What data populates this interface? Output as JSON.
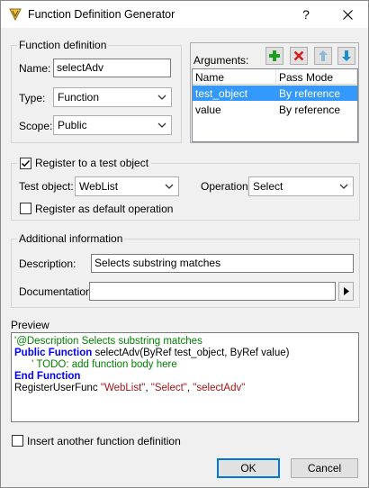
{
  "window": {
    "title": "Function Definition Generator",
    "help": "?",
    "close": "✕"
  },
  "function_definition": {
    "legend": "Function definition",
    "name_label": "Name:",
    "name_value": "selectAdv",
    "type_label": "Type:",
    "type_value": "Function",
    "scope_label": "Scope:",
    "scope_value": "Public"
  },
  "arguments": {
    "label": "Arguments:",
    "columns": [
      "Name",
      "Pass Mode"
    ],
    "rows": [
      {
        "name": "test_object",
        "mode": "By reference"
      },
      {
        "name": "value",
        "mode": "By reference"
      }
    ]
  },
  "register": {
    "legend": "Register to a test object",
    "checked": true,
    "test_object_label": "Test object:",
    "test_object_value": "WebList",
    "operation_label": "Operation:",
    "operation_value": "Select",
    "default_op_label": "Register as default operation",
    "default_op_checked": false
  },
  "additional": {
    "legend": "Additional information",
    "description_label": "Description:",
    "description_value": "Selects substring matches",
    "documentation_label": "Documentation:",
    "documentation_value": ""
  },
  "preview": {
    "label": "Preview",
    "line1": "'@Description Selects substring matches",
    "line2_kw": "Public Function",
    "line2_rest": " selectAdv(ByRef test_object, ByRef value)",
    "line3": "' TODO: add function body here",
    "line4_kw": "End Function",
    "line5_a": "RegisterUserFunc ",
    "line5_s1": "\"WebList\"",
    "line5_c1": ", ",
    "line5_s2": "\"Select\"",
    "line5_c2": ", ",
    "line5_s3": "\"selectAdv\""
  },
  "footer": {
    "insert_another_label": "Insert another function definition",
    "insert_another_checked": false,
    "ok": "OK",
    "cancel": "Cancel"
  },
  "colors": {
    "selection": "#3399ff",
    "keyword": "#0000ff",
    "comment": "#008000",
    "string": "#a31515",
    "default_button_border": "#0078d7"
  }
}
